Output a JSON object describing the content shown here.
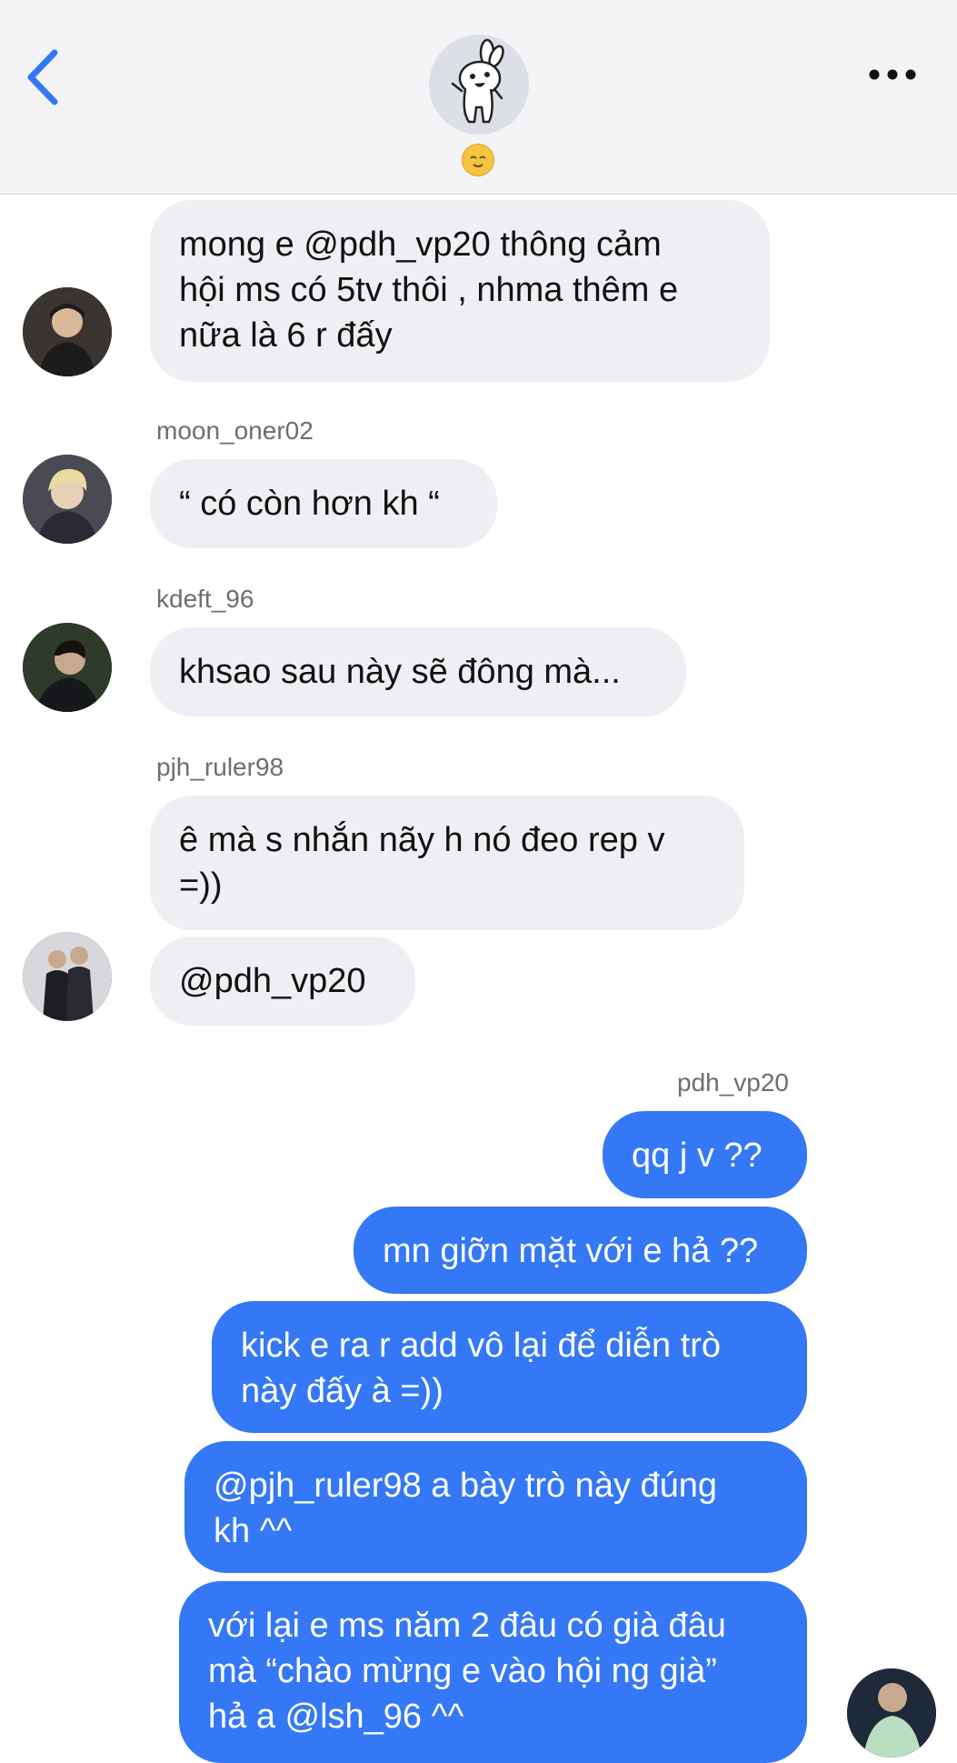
{
  "header": {
    "back_icon": "chevron-left-icon",
    "group_avatar_icon": "bunny-sticker-icon",
    "status_icon": "relieved-face-emoji",
    "more_icon": "ellipsis-icon"
  },
  "messages": [
    {
      "direction": "incoming",
      "sender": "",
      "text": "mong e @pdh_vp20 thông cảm\nhội ms có 5tv thôi , nhma thêm e\nnữa là 6 r đấy"
    },
    {
      "direction": "incoming",
      "sender": "moon_oner02",
      "text": "“ có còn hơn kh “"
    },
    {
      "direction": "incoming",
      "sender": "kdeft_96",
      "text": "khsao sau này sẽ đông mà..."
    },
    {
      "direction": "incoming",
      "sender": "pjh_ruler98",
      "text": "ê mà s nhắn nãy h nó đeo rep v\n=))"
    },
    {
      "direction": "incoming",
      "sender": "",
      "text": "@pdh_vp20"
    },
    {
      "direction": "outgoing",
      "sender": "pdh_vp20",
      "text": "qq j v ??"
    },
    {
      "direction": "outgoing",
      "sender": "",
      "text": "mn giỡn mặt với e hả ??"
    },
    {
      "direction": "outgoing",
      "sender": "",
      "text": "kick e ra r add vô lại để diễn trò\nnày đấy à =))"
    },
    {
      "direction": "outgoing",
      "sender": "",
      "text": "@pjh_ruler98 a bày trò này đúng\nkh ^^"
    },
    {
      "direction": "outgoing",
      "sender": "",
      "text": "với lại e ms năm 2 đâu có già đâu\nmà “chào mừng e vào hội ng già”\nhả a @lsh_96 ^^"
    }
  ],
  "colors": {
    "accent": "#3478f6",
    "incoming_bubble": "#efeff3",
    "header_bg": "#f4f4f6"
  }
}
